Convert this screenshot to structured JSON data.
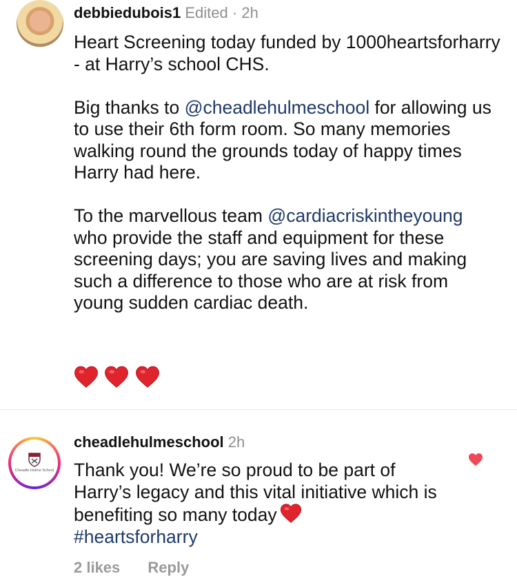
{
  "comment1": {
    "username": "debbiedubois1",
    "edited": "Edited",
    "separator": "·",
    "time": "2h",
    "paragraphs": [
      {
        "parts": [
          "Heart Screening today funded by 1000heartsforharry - at Harry’s school CHS."
        ]
      },
      {
        "before": "Big thanks to ",
        "mention": "@cheadlehulmeschool",
        "after": " for allowing us to use their 6th form room. So many memories walking round the grounds today of happy times Harry had here."
      },
      {
        "before": "To the marvellous team ",
        "mention": "@cardiacriskintheyoung",
        "after": " who provide the staff and equipment for these screening days; you are saving lives and making such a difference to those who are at risk from young sudden cardiac death."
      }
    ],
    "hearts": [
      "red-heart-emoji",
      "red-heart-emoji",
      "red-heart-emoji"
    ]
  },
  "comment2": {
    "username": "cheadlehulmeschool",
    "time": "2h",
    "avatar_caption": "Cheadle Hulme School",
    "text": "Thank you! We’re so proud to be part of Harry’s legacy and this vital initiative which is benefiting so many today",
    "hashtag": "#heartsforharry",
    "likes_label": "2 likes",
    "reply_label": "Reply",
    "liked": true
  },
  "colors": {
    "mention": "#1e3a68",
    "heart": "#e0242e",
    "meta": "#8e8e8e"
  }
}
